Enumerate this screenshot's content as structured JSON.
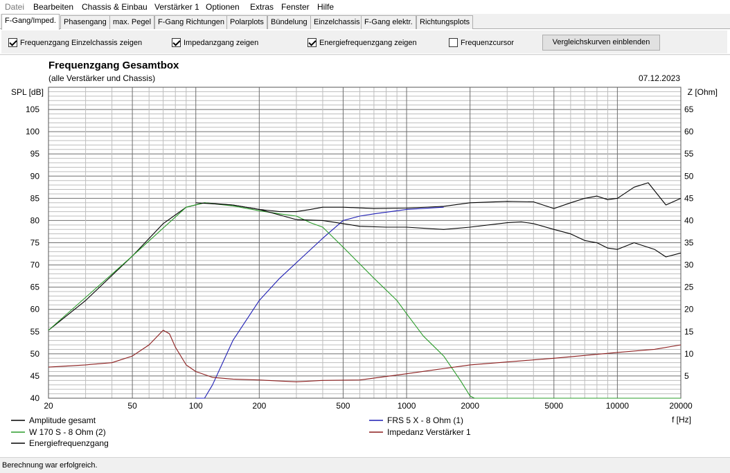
{
  "menubar": {
    "items": [
      "Datei",
      "Bearbeiten",
      "Chassis & Einbau",
      "Verstärker 1",
      "Optionen",
      "Extras",
      "Fenster",
      "Hilfe"
    ]
  },
  "tabs": [
    "F-Gang/Imped.",
    "Phasengang",
    "max. Pegel",
    "F-Gang Richtungen",
    "Polarplots",
    "Bündelung",
    "Einzelchassis",
    "F-Gang elektr.",
    "Richtungsplots"
  ],
  "active_tab": 0,
  "options": {
    "cb1": {
      "label": "Frequenzgang Einzelchassis zeigen",
      "checked": true
    },
    "cb2": {
      "label": "Impedanzgang zeigen",
      "checked": true
    },
    "cb3": {
      "label": "Energiefrequenzgang zeigen",
      "checked": true
    },
    "cb4": {
      "label": "Frequenzcursor",
      "checked": false
    },
    "compare_button": "Vergleichskurven einblenden"
  },
  "status": "Berechnung war erfolgreich.",
  "chart_data": {
    "type": "line",
    "title": "Frequenzgang Gesamtbox",
    "subtitle": "(alle Verstärker und Chassis)",
    "date": "07.12.2023",
    "xlabel": "f [Hz]",
    "ylabel_left": "SPL [dB]",
    "ylabel_right": "Z [Ohm]",
    "x_scale": "log",
    "xlim": [
      20,
      20000
    ],
    "ylim_left": [
      40,
      110
    ],
    "ylim_right": [
      0,
      70
    ],
    "x_ticks": [
      20,
      50,
      100,
      200,
      500,
      1000,
      2000,
      5000,
      10000,
      20000
    ],
    "x_tick_labels": [
      "20",
      "50",
      "100",
      "200",
      "500",
      "1000",
      "2000",
      "5000",
      "10000",
      "20000"
    ],
    "y_left_ticks": [
      40,
      45,
      50,
      55,
      60,
      65,
      70,
      75,
      80,
      85,
      90,
      95,
      100,
      105
    ],
    "y_left_tick_labels": [
      "40",
      "45",
      "50",
      "55",
      "60",
      "65",
      "70",
      "75",
      "80",
      "85",
      "90",
      "95",
      "100",
      "105"
    ],
    "y_right_ticks": [
      5,
      10,
      15,
      20,
      25,
      30,
      35,
      40,
      45,
      50,
      55,
      60,
      65
    ],
    "y_right_tick_labels": [
      "5",
      "10",
      "15",
      "20",
      "25",
      "30",
      "35",
      "40",
      "45",
      "50",
      "55",
      "60",
      "65"
    ],
    "grid": true,
    "legend_position": "bottom",
    "series": [
      {
        "name": "Amplitude gesamt",
        "color": "#000000",
        "axis": "left",
        "x": [
          20,
          30,
          50,
          70,
          90,
          110,
          150,
          200,
          250,
          300,
          350,
          400,
          500,
          700,
          1000,
          1500,
          2000,
          3000,
          4000,
          5000,
          6000,
          7000,
          8000,
          9000,
          10000,
          12000,
          14000,
          17000,
          20000
        ],
        "y": [
          55.3,
          62,
          72,
          79.3,
          83,
          84,
          83.5,
          82.5,
          82,
          82,
          82.5,
          83,
          83,
          82.7,
          82.8,
          83.2,
          84,
          84.3,
          84.2,
          82.7,
          84,
          85,
          85.5,
          84.7,
          85,
          87.5,
          88.5,
          83.5,
          85
        ]
      },
      {
        "name": "FRS 5 X - 8 Ohm (1)",
        "color": "#1c1cb4",
        "axis": "left",
        "x": [
          100,
          110,
          120,
          150,
          200,
          250,
          300,
          400,
          500,
          600,
          700,
          1000,
          1500
        ],
        "y": [
          40,
          40,
          43,
          53,
          62,
          67,
          70.5,
          76,
          80,
          81,
          81.5,
          82.5,
          83
        ]
      },
      {
        "name": "W 170 S - 8 Ohm (2)",
        "color": "#2a9c2a",
        "axis": "left",
        "x": [
          20,
          50,
          90,
          110,
          150,
          200,
          250,
          300,
          350,
          400,
          500,
          700,
          900,
          1000,
          1200,
          1500,
          1800,
          2000,
          2100,
          20000
        ],
        "y": [
          55.3,
          72,
          83,
          84,
          83.3,
          82.2,
          81.5,
          81,
          79.5,
          78.5,
          74,
          67,
          62,
          59,
          54,
          49.5,
          44,
          40.5,
          40,
          40
        ]
      },
      {
        "name": "Impedanz Verstärker 1",
        "color": "#8b1c1c",
        "axis": "right",
        "x": [
          20,
          30,
          40,
          50,
          60,
          70,
          75,
          80,
          90,
          100,
          120,
          150,
          200,
          300,
          400,
          600,
          1000,
          2000,
          5000,
          10000,
          15000,
          20000
        ],
        "y": [
          7,
          7.5,
          8,
          9.5,
          12,
          15.3,
          14.5,
          11.5,
          7.5,
          6,
          4.7,
          4.3,
          4.1,
          3.7,
          4,
          4.1,
          5.5,
          7.5,
          9,
          10.3,
          11,
          12
        ]
      },
      {
        "name": "Energiefrequenzgang",
        "color": "#000000",
        "axis": "left",
        "x": [
          100,
          150,
          200,
          300,
          400,
          500,
          600,
          800,
          1000,
          1500,
          2000,
          3000,
          3500,
          4000,
          5000,
          6000,
          7000,
          8000,
          9000,
          10000,
          12000,
          15000,
          17000,
          20000
        ],
        "y": [
          84,
          83.5,
          82.5,
          80.2,
          80,
          79.3,
          78.7,
          78.5,
          78.5,
          78,
          78.5,
          79.5,
          79.7,
          79.3,
          78,
          77,
          75.5,
          75,
          73.8,
          73.5,
          75,
          73.5,
          71.8,
          72.7
        ]
      }
    ]
  }
}
